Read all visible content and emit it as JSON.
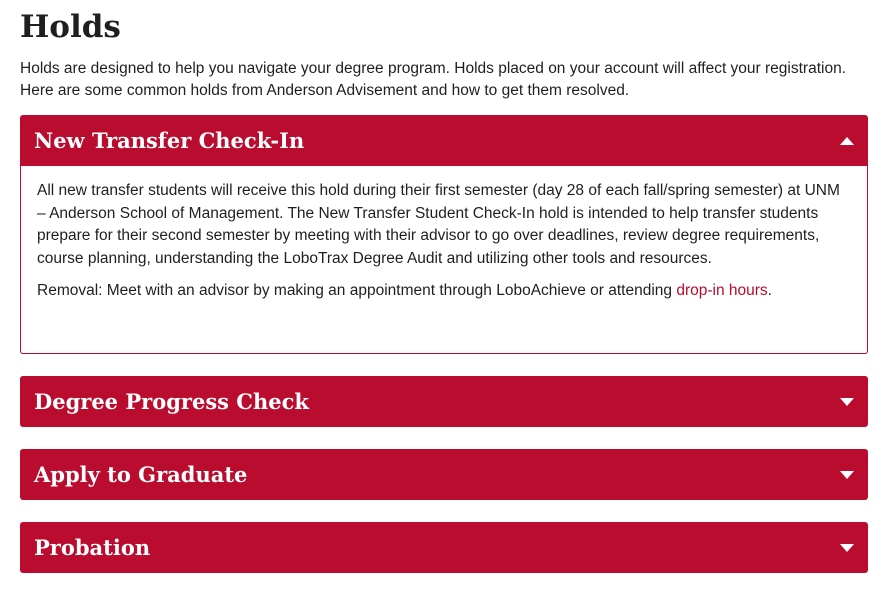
{
  "page": {
    "title": "Holds",
    "intro": "Holds are designed to help you navigate your degree program. Holds placed on your account will affect your registration. Here are some common holds from Anderson Advisement and how to get them resolved."
  },
  "accordion": {
    "items": [
      {
        "title": "New Transfer Check-In",
        "expanded": true,
        "icon": "chevron-up-icon",
        "body": "All new transfer students will receive this hold during their first semester (day 28 of each fall/spring semester) at UNM – Anderson School of Management. The New Transfer Student Check-In hold is intended to help transfer students prepare for their second semester by meeting with their advisor to go over deadlines, review degree requirements, course planning, understanding the LoboTrax Degree Audit and utilizing other tools and resources.",
        "removal_text": "Removal: Meet with an advisor by making an appointment through LoboAchieve or attending ",
        "removal_link": "drop-in hours",
        "removal_end": "."
      },
      {
        "title": "Degree Progress Check",
        "expanded": false,
        "icon": "chevron-down-icon"
      },
      {
        "title": "Apply to Graduate",
        "expanded": false,
        "icon": "chevron-down-icon"
      },
      {
        "title": "Probation",
        "expanded": false,
        "icon": "chevron-down-icon"
      }
    ]
  },
  "colors": {
    "accent": "#ba0c2f",
    "text": "#1f1f1f",
    "header_text": "#ffffff"
  }
}
